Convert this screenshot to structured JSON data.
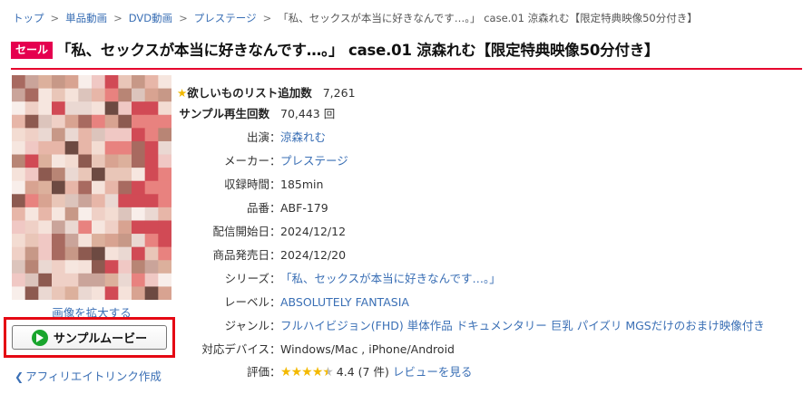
{
  "breadcrumb": [
    "トップ",
    "単品動画",
    "DVD動画",
    "プレステージ",
    "「私、セックスが本当に好きなんです…。」 case.01 涼森れむ【限定特典映像50分付き】"
  ],
  "breadcrumb_separator": ">",
  "sale_badge": "セール",
  "title": "「私、セックスが本当に好きなんです…。」 case.01 涼森れむ【限定特典映像50分付き】",
  "image": {
    "enlarge_label": "画像を拡大する"
  },
  "sample_button": {
    "label": "サンプルムービー"
  },
  "affiliate_link": "アフィリエイトリンク作成",
  "wishlist": {
    "label": "欲しいものリスト追加数",
    "value": "7,261"
  },
  "sample_plays": {
    "label": "サンプル再生回数",
    "value": "70,443",
    "unit": "回"
  },
  "details": [
    {
      "label": "出演",
      "value": "涼森れむ",
      "link": true
    },
    {
      "label": "メーカー",
      "value": "プレステージ",
      "link": true
    },
    {
      "label": "収録時間",
      "value": "185min",
      "link": false
    },
    {
      "label": "品番",
      "value": "ABF-179",
      "link": false
    },
    {
      "label": "配信開始日",
      "value": "2024/12/12",
      "link": false
    },
    {
      "label": "商品発売日",
      "value": "2024/12/20",
      "link": false
    },
    {
      "label": "シリーズ",
      "value": "「私、セックスが本当に好きなんです…。」",
      "link": true
    },
    {
      "label": "レーベル",
      "value": "ABSOLUTELY FANTASIA",
      "link": true
    },
    {
      "label": "ジャンル",
      "value": "",
      "link": true
    },
    {
      "label": "対応デバイス",
      "value": "Windows/Mac , iPhone/Android",
      "link": false
    },
    {
      "label": "評価",
      "value": "",
      "link": false
    }
  ],
  "genres": [
    "フルハイビジョン(FHD)",
    "単体作品",
    "ドキュメンタリー",
    "巨乳",
    "パイズリ",
    "MGSだけのおまけ映像付き"
  ],
  "rating": {
    "score": "4.4",
    "count_text": "(7 件)",
    "review_link": "レビューを見る",
    "stars_filled": 4.4,
    "stars_max": 5
  },
  "colors": {
    "accent_red": "#e6002d",
    "link_blue": "#3a6fb5",
    "badge_pink": "#e5004f",
    "play_green": "#19a52d",
    "star_gold": "#f3b900"
  },
  "icons": {
    "play": "play-circle-icon",
    "share": "share-icon",
    "wishlist_star": "star-icon"
  }
}
